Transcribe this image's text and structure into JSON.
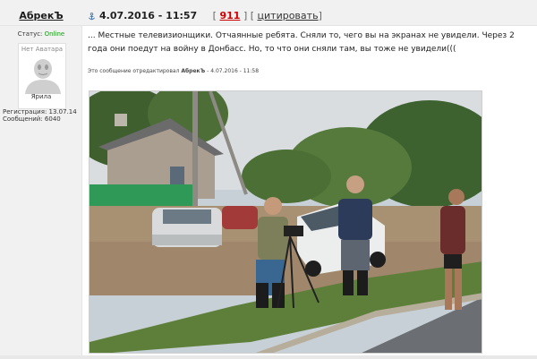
{
  "author": {
    "name": "АбрекЪ"
  },
  "post_meta": {
    "date": "4.07.2016 - 11:57",
    "post_number": "911",
    "bracket_open": "[",
    "bracket_close": "]",
    "bracket_open_2": "[",
    "bracket_close_2": "]",
    "quote_label": "цитировать"
  },
  "user_panel": {
    "status_label": "Статус:",
    "status_value": "Online",
    "avatar_placeholder": "Нет Аватара",
    "rank": "Ярила",
    "registration": "Регистрация: 13.07.14",
    "messages": "Сообщений: 6040"
  },
  "post": {
    "text": "... Местные телевизионщики. Отчаянные ребята. Сняли то, чего вы на экранах не увидели. Через 2 года они поедут на войну в Донбасс. Но, то что они сняли там, вы тоже не увидели(((",
    "edited_prefix": "Это сообщение отредактировал",
    "edited_by": "АбрекЪ",
    "edited_time": "- 4.07.2016 - 11:58"
  },
  "colors": {
    "online": "#1a9a1a",
    "post_number": "#cc0000",
    "panel_bg": "#f1f1f1"
  },
  "icons": {
    "anchor": "anchor-icon",
    "avatar": "default-avatar-icon"
  }
}
